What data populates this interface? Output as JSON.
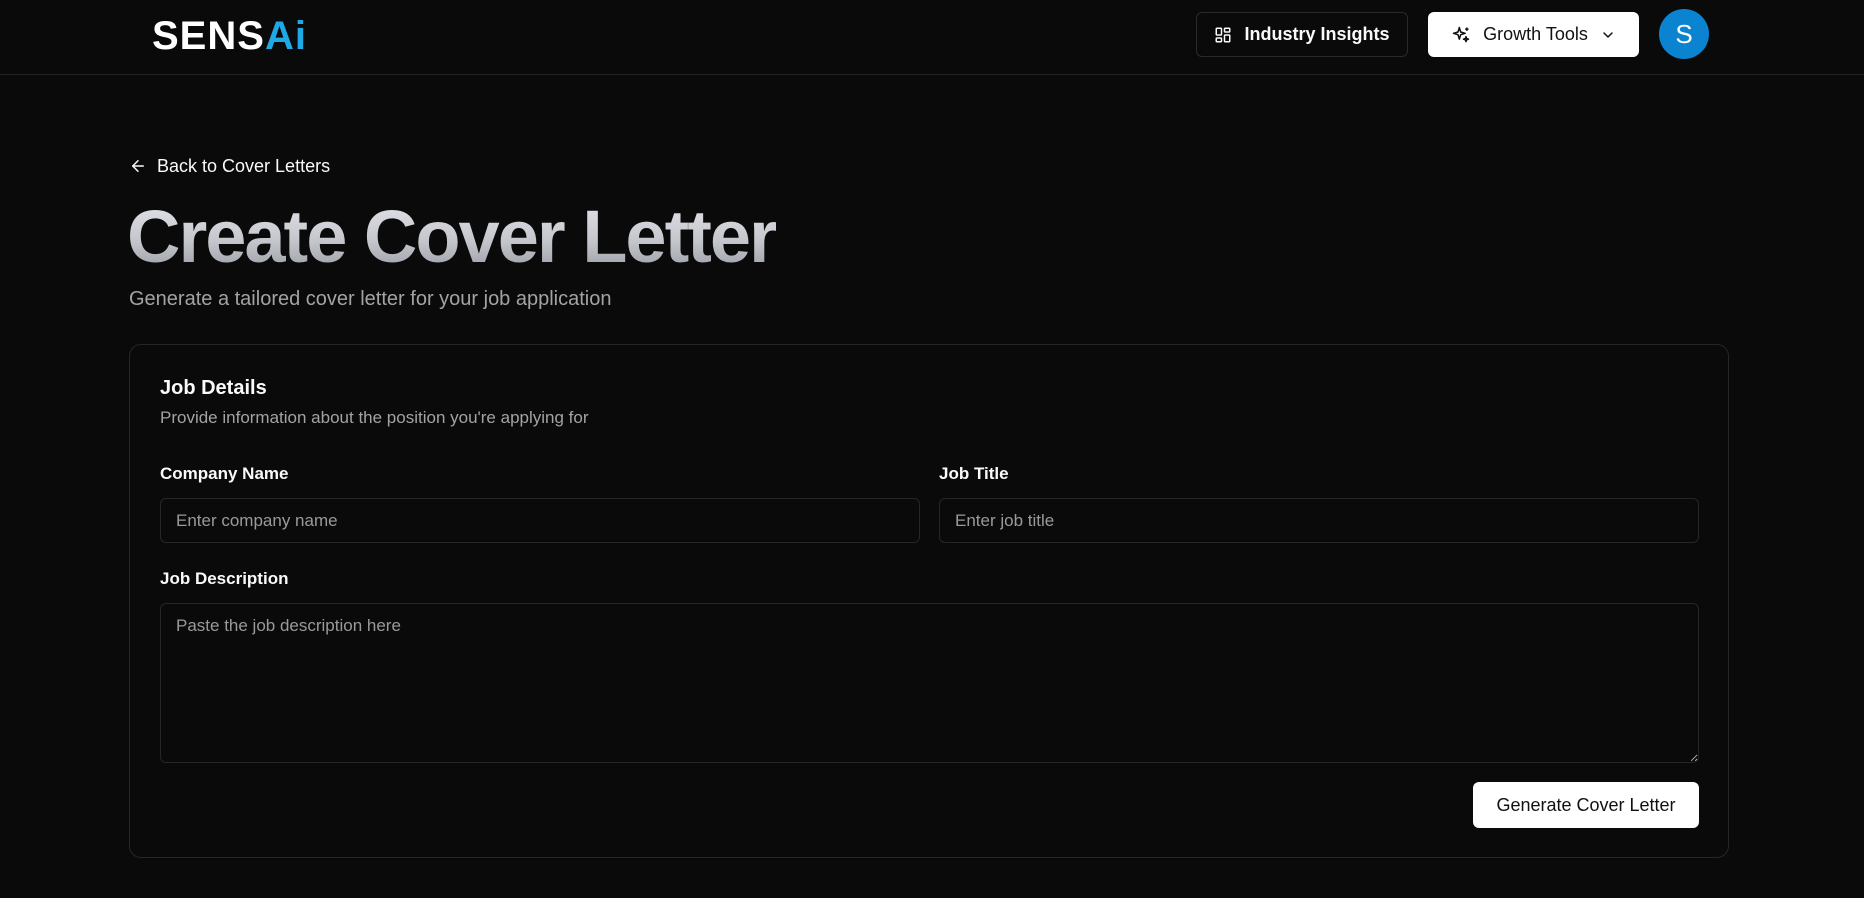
{
  "navbar": {
    "logo_part1": "SENS",
    "logo_part2": "Ai",
    "industry_insights_label": "Industry Insights",
    "industry_insights_icon": "layout-dashboard-icon",
    "growth_tools_label": "Growth Tools",
    "growth_tools_icon": "sparkles-icon",
    "growth_tools_chevron": "chevron-down-icon",
    "avatar_initial": "S",
    "avatar_color": "#0a84d0"
  },
  "page": {
    "back_link_label": "Back to Cover Letters",
    "back_icon": "arrow-left-icon",
    "title": "Create Cover Letter",
    "subtitle": "Generate a tailored cover letter for your job application"
  },
  "form": {
    "card_title": "Job Details",
    "card_description": "Provide information about the position you're applying for",
    "company_name": {
      "label": "Company Name",
      "placeholder": "Enter company name",
      "value": ""
    },
    "job_title": {
      "label": "Job Title",
      "placeholder": "Enter job title",
      "value": ""
    },
    "job_description": {
      "label": "Job Description",
      "placeholder": "Paste the job description here",
      "value": ""
    },
    "submit_label": "Generate Cover Letter"
  },
  "colors": {
    "background": "#0a0a0a",
    "border": "#262626",
    "muted_text": "#a3a3a3",
    "accent": "#1fa8e6"
  }
}
